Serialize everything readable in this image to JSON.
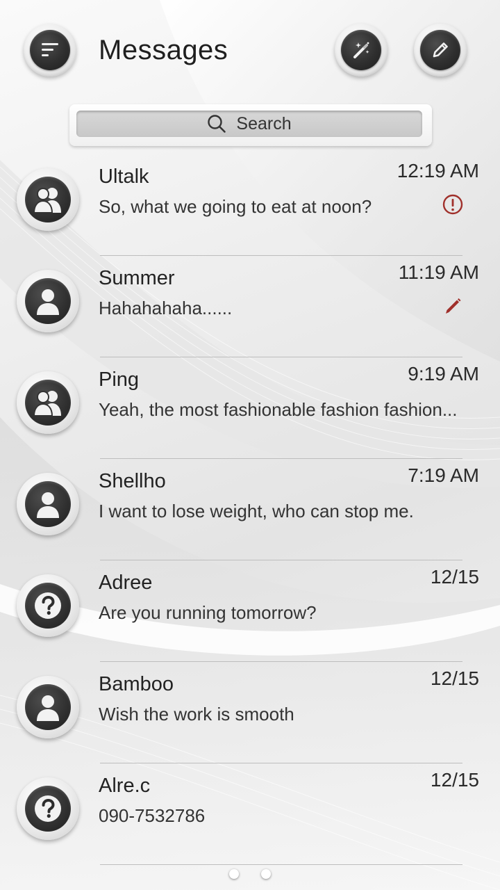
{
  "header": {
    "title": "Messages",
    "menu_icon": "menu-icon",
    "theme_icon": "magic-wand-icon",
    "compose_icon": "compose-icon"
  },
  "search": {
    "label": "Search",
    "icon": "search-icon"
  },
  "accent_color": "#a0302b",
  "conversations": [
    {
      "name": "Ultalk",
      "time": "12:19 AM",
      "preview": "So, what we going to eat at noon?",
      "avatar": "group-icon",
      "status": "error-icon"
    },
    {
      "name": "Summer",
      "time": "11:19 AM",
      "preview": "Hahahahaha......",
      "avatar": "person-icon",
      "status": "draft-pencil-icon"
    },
    {
      "name": "Ping",
      "time": "9:19 AM",
      "preview": "Yeah, the most fashionable fashion fashion...",
      "avatar": "group-icon",
      "status": ""
    },
    {
      "name": "Shellho",
      "time": "7:19 AM",
      "preview": "I want to lose weight, who can stop me.",
      "avatar": "person-icon",
      "status": ""
    },
    {
      "name": "Adree",
      "time": "12/15",
      "preview": "Are you running tomorrow?",
      "avatar": "unknown-contact-icon",
      "status": ""
    },
    {
      "name": "Bamboo",
      "time": "12/15",
      "preview": "Wish the work is smooth",
      "avatar": "person-icon",
      "status": ""
    },
    {
      "name": "Alre.c",
      "time": "12/15",
      "preview": "090-7532786",
      "avatar": "unknown-contact-icon",
      "status": ""
    }
  ],
  "pager": {
    "pages": 2,
    "current": 1
  }
}
